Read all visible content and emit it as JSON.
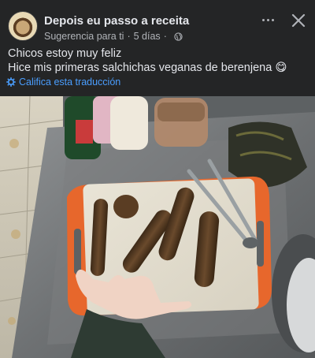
{
  "post": {
    "author": "Depois eu passo a receita",
    "suggestion": "Sugerencia para ti",
    "time": "5 días",
    "text_line1": "Chicos estoy muy feliz",
    "text_line2": "Hice mis primeras salchichas veganas de berenjena",
    "emoji": "😋",
    "translate_label": "Califica esta traducción"
  },
  "icons": {
    "more": "more-icon",
    "close": "close-icon",
    "privacy": "globe-icon",
    "translate": "gear-icon"
  },
  "colors": {
    "background": "#242526",
    "text": "#e4e6eb",
    "secondary_text": "#b0b3b8",
    "link": "#4a9eff"
  }
}
